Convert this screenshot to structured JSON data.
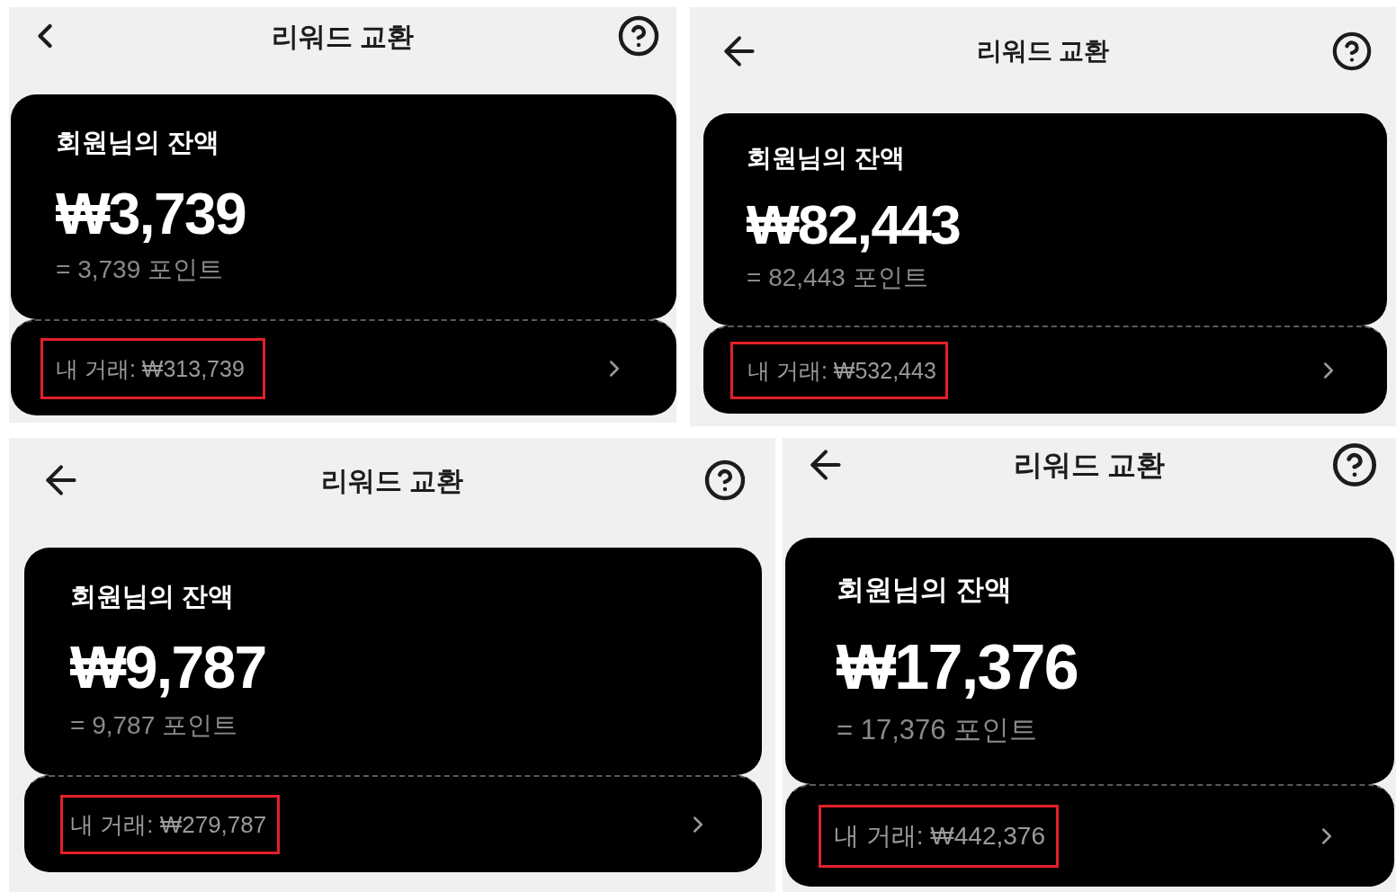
{
  "panels": [
    {
      "header": {
        "back_button": {
          "kind": "chevron"
        },
        "title": "리워드 교환"
      },
      "balance": {
        "label": "회원님의 잔액",
        "amount": "₩3,739",
        "points": "= 3,739 포인트"
      },
      "transactions": {
        "text": "내 거래: ₩313,739",
        "highlighted": true
      }
    },
    {
      "header": {
        "back_button": {
          "kind": "arrow"
        },
        "title": "리워드 교환"
      },
      "balance": {
        "label": "회원님의 잔액",
        "amount": "₩82,443",
        "points": "= 82,443 포인트"
      },
      "transactions": {
        "text": "내 거래: ₩532,443",
        "highlighted": true
      }
    },
    {
      "header": {
        "back_button": {
          "kind": "arrow"
        },
        "title": "리워드 교환"
      },
      "balance": {
        "label": "회원님의 잔액",
        "amount": "₩9,787",
        "points": "= 9,787 포인트"
      },
      "transactions": {
        "text": "내 거래: ₩279,787",
        "highlighted": true
      }
    },
    {
      "header": {
        "back_button": {
          "kind": "arrow"
        },
        "title": "리워드 교환"
      },
      "balance": {
        "label": "회원님의 잔액",
        "amount": "₩17,376",
        "points": "= 17,376 포인트"
      },
      "transactions": {
        "text": "내 거래: ₩442,376",
        "highlighted": true
      }
    }
  ]
}
